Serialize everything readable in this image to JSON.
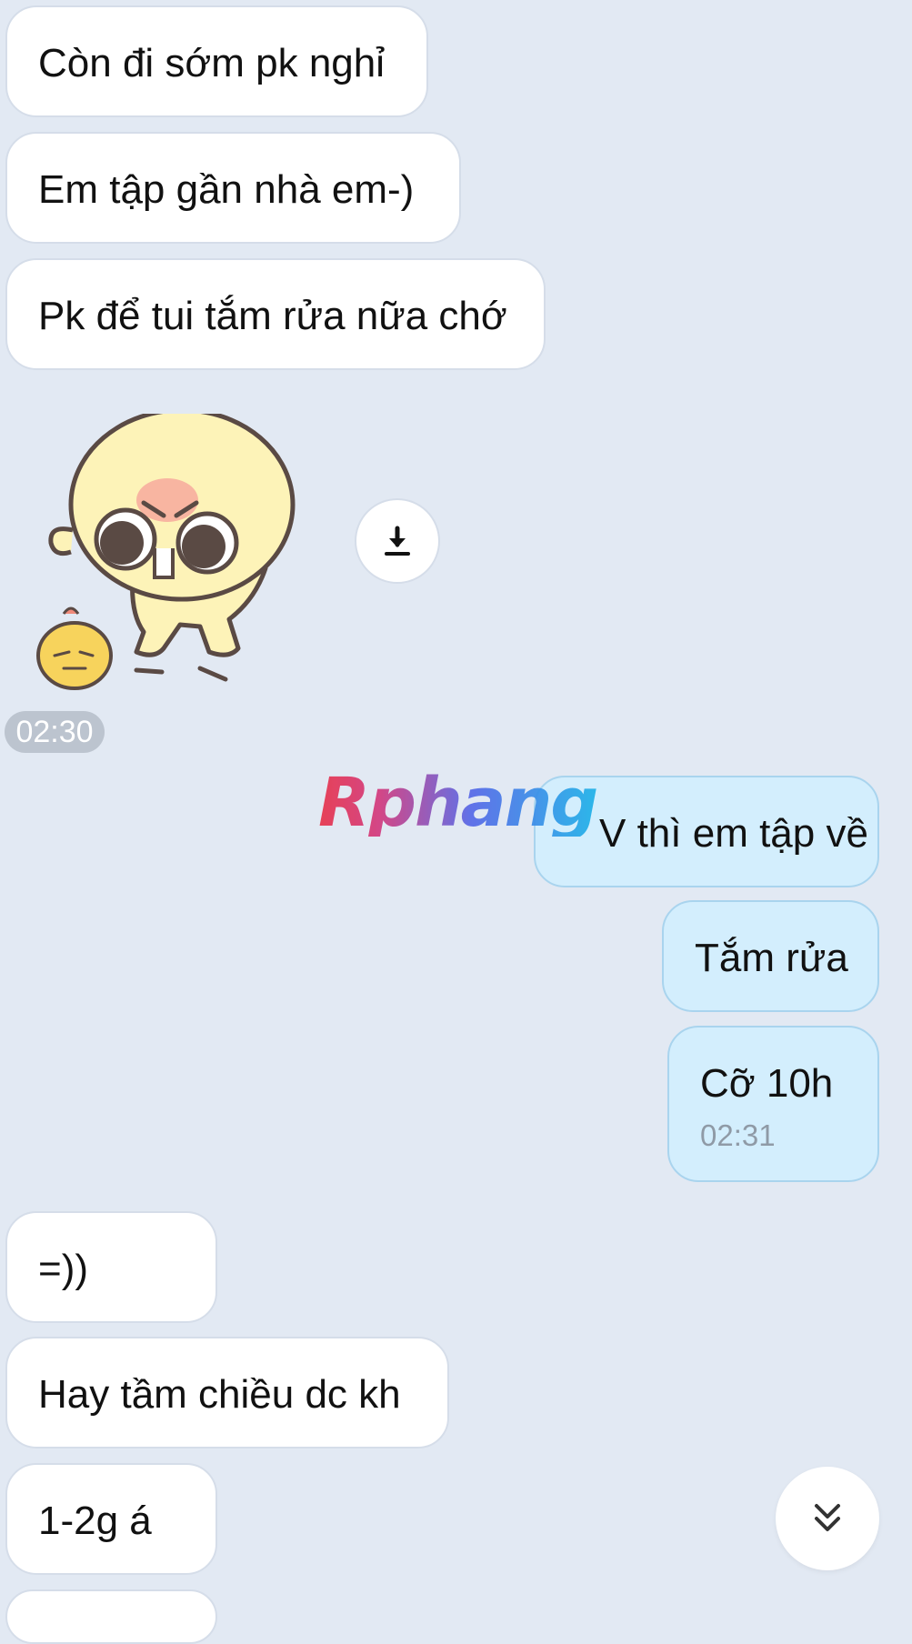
{
  "messages": {
    "m1": "Còn đi sớm pk nghỉ",
    "m2": "Em tập gần nhà em-)",
    "m3": "Pk để tui tắm rửa nữa chớ",
    "m4": "V thì em tập về",
    "m5": "Tắm rửa",
    "m6": "Cỡ 10h",
    "m7": "=))",
    "m8": "Hay tầm chiều dc kh",
    "m9": "1-2g á"
  },
  "timestamps": {
    "sticker_time": "02:30",
    "outgoing_time": "02:31"
  },
  "watermark": "Rphang",
  "icons": {
    "download": "download-icon",
    "scroll": "double-chevron-down-icon"
  },
  "colors": {
    "background": "#e2e9f3",
    "incoming_bubble": "#ffffff",
    "outgoing_bubble": "#d3eefd"
  }
}
